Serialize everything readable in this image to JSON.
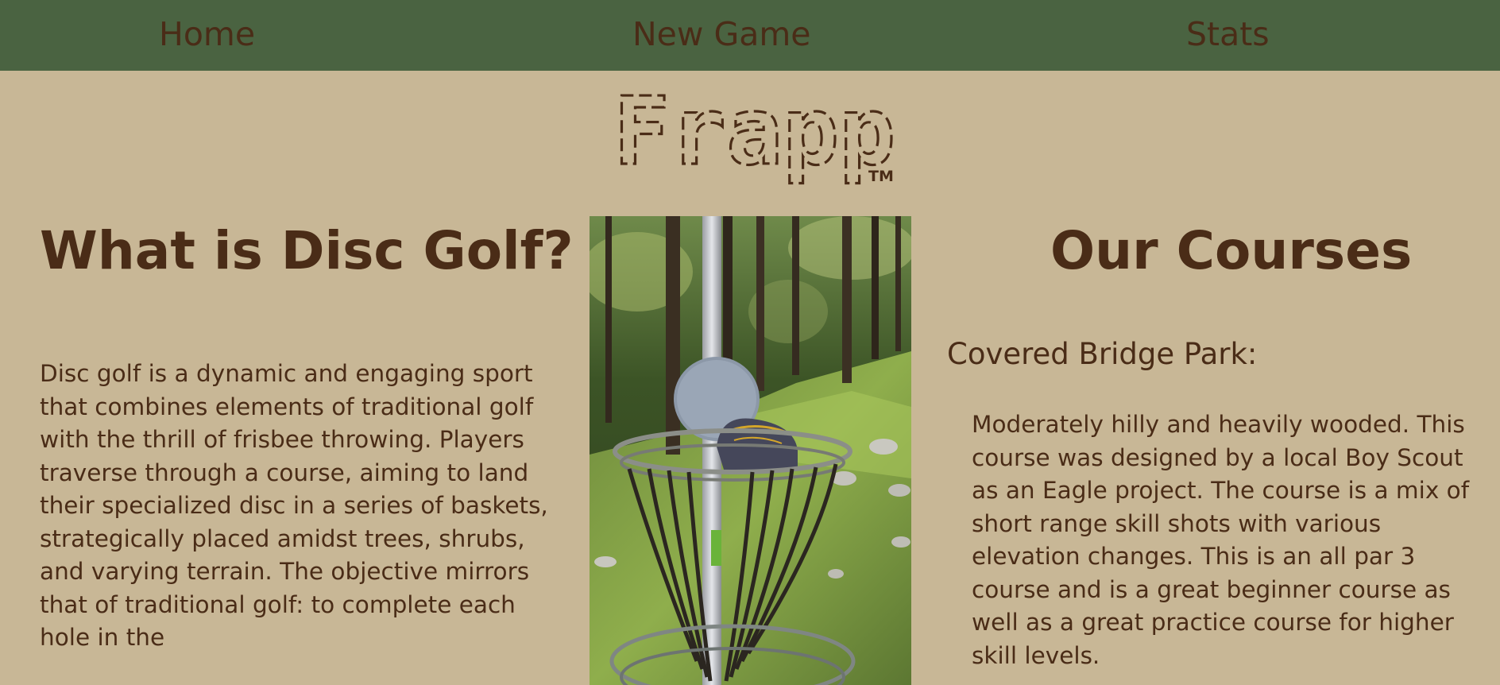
{
  "nav": {
    "home": "Home",
    "new_game": "New Game",
    "stats": "Stats"
  },
  "logo": {
    "text": "Frapp",
    "trademark": "TM"
  },
  "left": {
    "heading": "What is Disc Golf?",
    "body": "Disc golf is a dynamic and engaging sport that combines elements of traditional golf with the thrill of frisbee throwing. Players traverse through a course, aiming to land their specialized disc in a series of baskets, strategically placed amidst trees, shrubs, and varying terrain. The objective mirrors that of traditional golf: to complete each hole in the"
  },
  "right": {
    "heading": "Our Courses",
    "course_name": "Covered Bridge Park:",
    "course_description": "Moderately hilly and heavily wooded. This course was designed by a local Boy Scout as an Eagle project. The course is a mix of short range skill shots with various elevation changes. This is an all par 3 course and is a great beginner course as well as a great practice course for higher skill levels."
  },
  "colors": {
    "background": "#c8b796",
    "nav_background": "#4a6341",
    "text": "#4a2c17"
  },
  "icons": {
    "photo": "disc-golf-basket-photo"
  }
}
